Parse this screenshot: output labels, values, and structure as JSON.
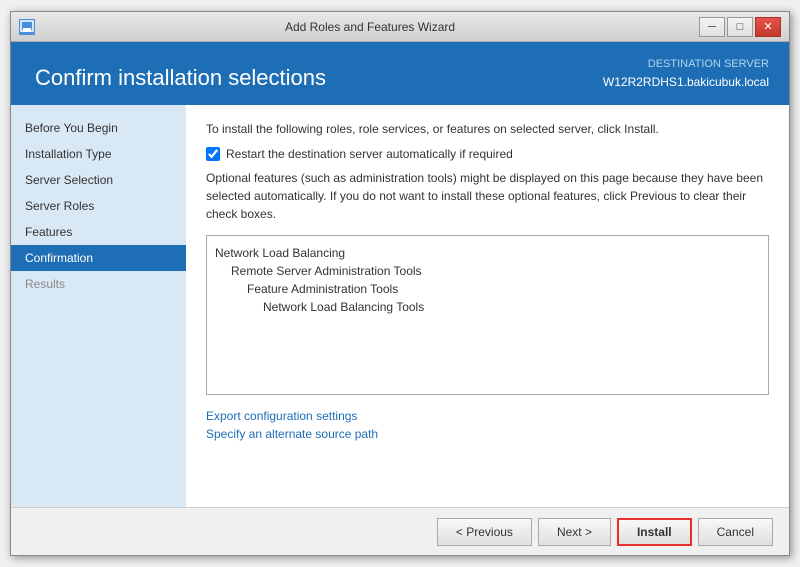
{
  "window": {
    "title": "Add Roles and Features Wizard",
    "controls": {
      "minimize": "─",
      "restore": "□",
      "close": "✕"
    }
  },
  "header": {
    "title": "Confirm installation selections",
    "destination_label": "DESTINATION SERVER",
    "server_name": "W12R2RDHS1.bakicubuk.local"
  },
  "sidebar": {
    "items": [
      {
        "label": "Before You Begin",
        "state": "normal"
      },
      {
        "label": "Installation Type",
        "state": "normal"
      },
      {
        "label": "Server Selection",
        "state": "normal"
      },
      {
        "label": "Server Roles",
        "state": "normal"
      },
      {
        "label": "Features",
        "state": "normal"
      },
      {
        "label": "Confirmation",
        "state": "active"
      },
      {
        "label": "Results",
        "state": "disabled"
      }
    ]
  },
  "main": {
    "instruction": "To install the following roles, role services, or features on selected server, click Install.",
    "checkbox_label": "Restart the destination server automatically if required",
    "checkbox_checked": true,
    "optional_text": "Optional features (such as administration tools) might be displayed on this page because they have been selected automatically. If you do not want to install these optional features, click Previous to clear their check boxes.",
    "features": [
      {
        "label": "Network Load Balancing",
        "indent": 0
      },
      {
        "label": "Remote Server Administration Tools",
        "indent": 1
      },
      {
        "label": "Feature Administration Tools",
        "indent": 2
      },
      {
        "label": "Network Load Balancing Tools",
        "indent": 3
      }
    ],
    "links": [
      {
        "label": "Export configuration settings"
      },
      {
        "label": "Specify an alternate source path"
      }
    ]
  },
  "footer": {
    "previous_label": "< Previous",
    "next_label": "Next >",
    "install_label": "Install",
    "cancel_label": "Cancel"
  }
}
